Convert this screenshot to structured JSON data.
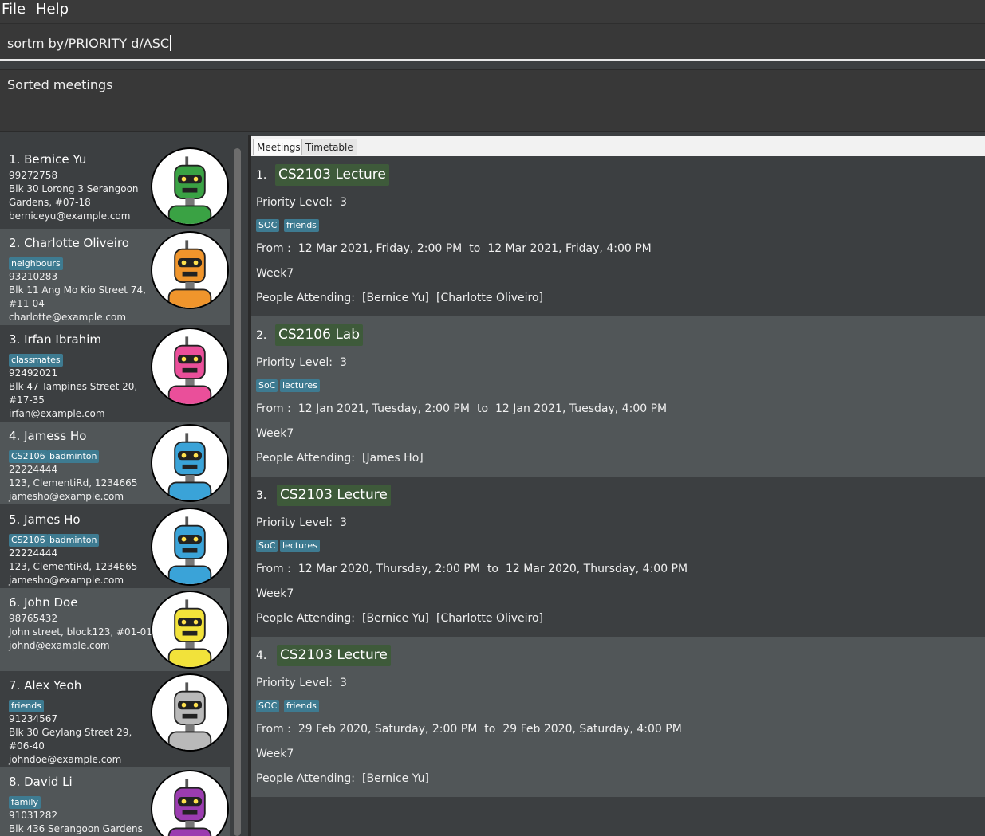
{
  "menu": {
    "file": "File",
    "help": "Help"
  },
  "command": {
    "value": "sortm by/PRIORITY d/ASC"
  },
  "result": {
    "text": "Sorted meetings"
  },
  "tabs": {
    "meetings": "Meetings",
    "timetable": "Timetable"
  },
  "persons": [
    {
      "index": "1.",
      "name": "Bernice Yu",
      "tags": [],
      "phone": "99272758",
      "address": [
        "Blk 30 Lorong 3 Serangoon",
        "Gardens, #07-18"
      ],
      "email": "berniceyu@example.com",
      "avatar": "green-robot-avatar",
      "color": "#3aa244"
    },
    {
      "index": "2.",
      "name": "Charlotte Oliveiro",
      "tags": [
        "neighbours"
      ],
      "phone": "93210283",
      "address": [
        "Blk 11 Ang Mo Kio Street 74,",
        "#11-04"
      ],
      "email": "charlotte@example.com",
      "avatar": "orange-robot-avatar",
      "color": "#f0952c"
    },
    {
      "index": "3.",
      "name": "Irfan Ibrahim",
      "tags": [
        "classmates"
      ],
      "phone": "92492021",
      "address": [
        "Blk 47 Tampines Street 20,",
        "#17-35"
      ],
      "email": "irfan@example.com",
      "avatar": "pink-robot-avatar",
      "color": "#ea4f9a"
    },
    {
      "index": "4.",
      "name": "Jamess Ho",
      "tags": [
        "CS2106",
        "badminton"
      ],
      "phone": "22224444",
      "address": [
        "123, ClementiRd, 1234665"
      ],
      "email": "jamesho@example.com",
      "avatar": "blue-robot-avatar",
      "color": "#3aa3d8"
    },
    {
      "index": "5.",
      "name": "James Ho",
      "tags": [
        "CS2106",
        "badminton"
      ],
      "phone": "22224444",
      "address": [
        "123, ClementiRd, 1234665"
      ],
      "email": "jamesho@example.com",
      "avatar": "blue-robot-avatar",
      "color": "#3aa3d8"
    },
    {
      "index": "6.",
      "name": "John Doe",
      "tags": [],
      "phone": "98765432",
      "address": [
        "John street, block123, #01-01"
      ],
      "email": "johnd@example.com",
      "avatar": "yellow-robot-avatar",
      "color": "#f2e23a"
    },
    {
      "index": "7.",
      "name": "Alex Yeoh",
      "tags": [
        "friends"
      ],
      "phone": "91234567",
      "address": [
        "Blk 30 Geylang Street 29,",
        "#06-40"
      ],
      "email": "johndoe@example.com",
      "avatar": "grey-robot-avatar",
      "color": "#b9b9b9"
    },
    {
      "index": "8.",
      "name": "David Li",
      "tags": [
        "family"
      ],
      "phone": "91031282",
      "address": [
        "Blk 436 Serangoon Gardens"
      ],
      "email": "",
      "avatar": "purple-robot-avatar",
      "color": "#9b3cb0"
    }
  ],
  "meetings": [
    {
      "index": "1.",
      "title": "CS2103 Lecture",
      "priority_label": "Priority Level:",
      "priority": "3",
      "tags": [
        "SOC",
        "friends"
      ],
      "from_label": "From :",
      "from": "12 Mar 2021, Friday, 2:00 PM",
      "to_label": "to",
      "to": "12 Mar 2021, Friday, 4:00 PM",
      "week": "Week7",
      "people_label": "People Attending:",
      "people": [
        "[Bernice Yu]",
        "[Charlotte Oliveiro]"
      ]
    },
    {
      "index": "2.",
      "title": "CS2106 Lab",
      "priority_label": "Priority Level:",
      "priority": "3",
      "tags": [
        "SoC",
        "lectures"
      ],
      "from_label": "From :",
      "from": "12 Jan 2021, Tuesday, 2:00 PM",
      "to_label": "to",
      "to": "12 Jan 2021, Tuesday, 4:00 PM",
      "week": "Week7",
      "people_label": "People Attending:",
      "people": [
        "[James Ho]"
      ]
    },
    {
      "index": "3.",
      "title": "CS2103 Lecture",
      "priority_label": "Priority Level:",
      "priority": "3",
      "tags": [
        "SoC",
        "lectures"
      ],
      "from_label": "From :",
      "from": "12 Mar 2020, Thursday, 2:00 PM",
      "to_label": "to",
      "to": "12 Mar 2020, Thursday, 4:00 PM",
      "week": "Week7",
      "people_label": "People Attending:",
      "people": [
        "[Bernice Yu]",
        "[Charlotte Oliveiro]"
      ]
    },
    {
      "index": "4.",
      "title": "CS2103 Lecture",
      "priority_label": "Priority Level:",
      "priority": "3",
      "tags": [
        "SOC",
        "friends"
      ],
      "from_label": "From :",
      "from": "29 Feb 2020, Saturday, 2:00 PM",
      "to_label": "to",
      "to": "29 Feb 2020, Saturday, 4:00 PM",
      "week": "Week7",
      "people_label": "People Attending:",
      "people": [
        "[Bernice Yu]"
      ]
    }
  ]
}
